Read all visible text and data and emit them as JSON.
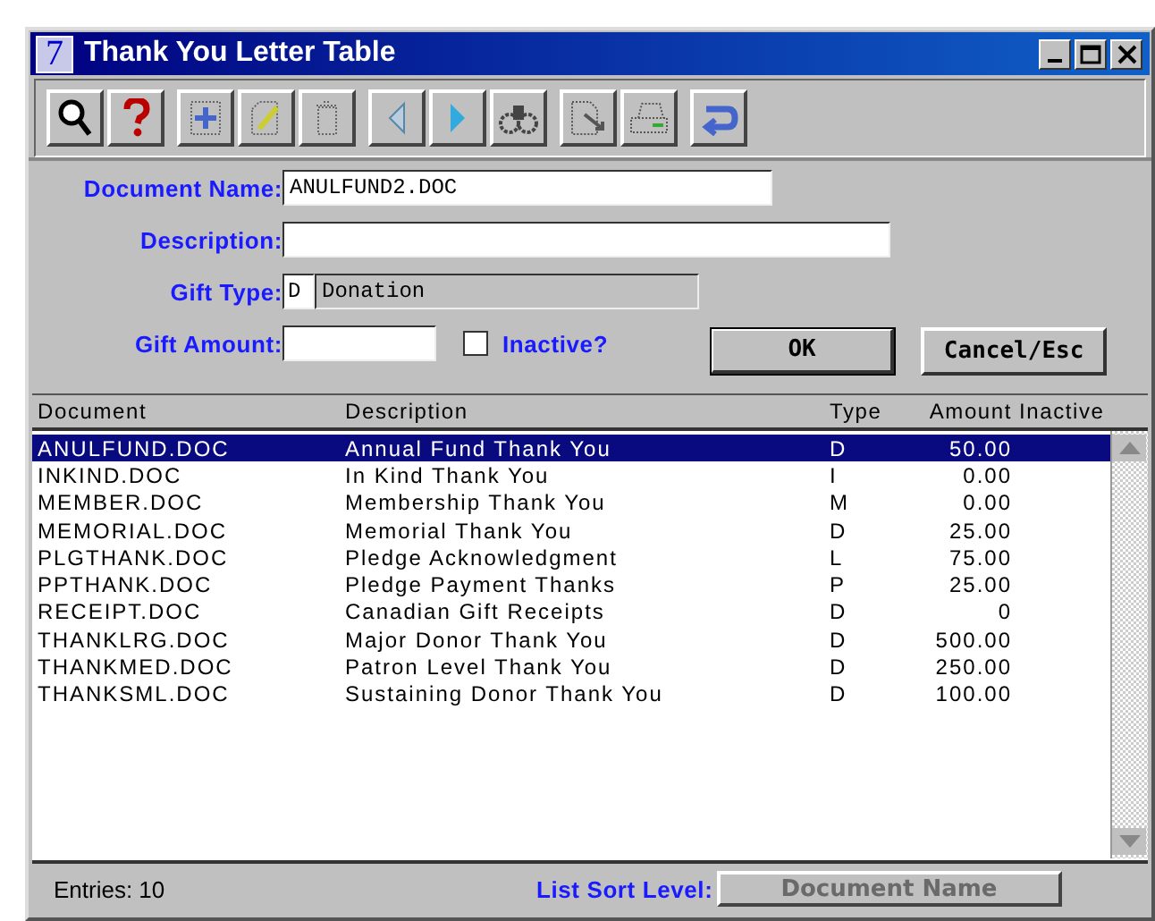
{
  "window": {
    "app_glyph": "7",
    "title": "Thank You Letter Table"
  },
  "form": {
    "document_name": {
      "label": "Document Name:",
      "value": "ANULFUND2.DOC"
    },
    "description": {
      "label": "Description:"
    },
    "gift_type": {
      "label": "Gift Type:",
      "code": "D",
      "name": "Donation"
    },
    "gift_amount": {
      "label": "Gift Amount:"
    },
    "inactive": {
      "label": "Inactive?",
      "checked": false
    },
    "buttons": [
      {
        "label": "OK",
        "default": true
      },
      {
        "label": "Cancel/Esc",
        "default": false
      }
    ]
  },
  "table": {
    "columns": [
      "Document",
      "Description",
      "Type",
      "Amount",
      "Inactive"
    ],
    "rows": [
      {
        "cells": [
          "ANULFUND.DOC",
          "Annual Fund Thank You",
          "D",
          "50.00"
        ],
        "selected": true
      },
      {
        "cells": [
          "INKIND.DOC",
          "In Kind Thank You",
          "I",
          "0.00"
        ],
        "selected": false
      },
      {
        "cells": [
          "MEMBER.DOC",
          "Membership Thank You",
          "M",
          "0.00"
        ],
        "selected": false
      },
      {
        "cells": [
          "MEMORIAL.DOC",
          "Memorial Thank You",
          "D",
          "25.00"
        ],
        "selected": false
      },
      {
        "cells": [
          "PLGTHANK.DOC",
          "Pledge Acknowledgment",
          "L",
          "75.00"
        ],
        "selected": false
      },
      {
        "cells": [
          "PPTHANK.DOC",
          "Pledge Payment Thanks",
          "P",
          "25.00"
        ],
        "selected": false
      },
      {
        "cells": [
          "RECEIPT.DOC",
          "Canadian Gift Receipts",
          "D",
          "0"
        ],
        "selected": false
      },
      {
        "cells": [
          "THANKLRG.DOC",
          "Major Donor Thank You",
          "D",
          "500.00"
        ],
        "selected": false
      },
      {
        "cells": [
          "THANKMED.DOC",
          "Patron Level Thank You",
          "D",
          "250.00"
        ],
        "selected": false
      },
      {
        "cells": [
          "THANKSML.DOC",
          "Sustaining Donor Thank You",
          "D",
          "100.00"
        ],
        "selected": false
      }
    ]
  },
  "status_bar": {
    "entries": "Entries: 10",
    "sort_label": "List Sort Level:",
    "sort_value": "Document Name"
  }
}
